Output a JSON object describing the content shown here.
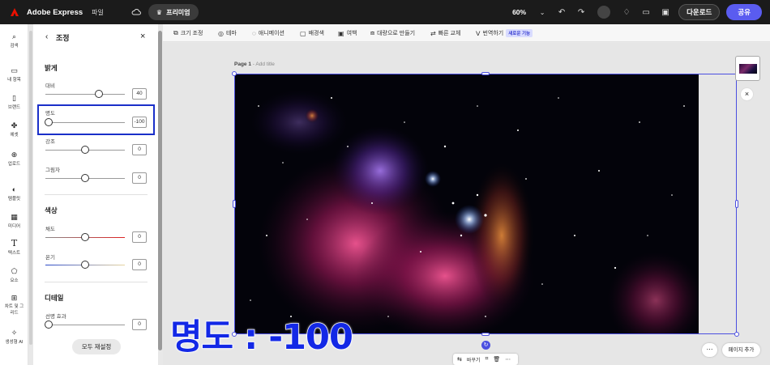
{
  "topbar": {
    "app_title": "Adobe Express",
    "file_menu": "파일",
    "premium_label": "프리미엄",
    "zoom": "60%",
    "download_label": "다운로드",
    "share_label": "공유"
  },
  "rail": {
    "items": [
      {
        "label": "검색",
        "icon": "search-icon"
      },
      {
        "label": "내 항목",
        "icon": "folder-icon"
      },
      {
        "label": "브랜드",
        "icon": "brand-icon"
      },
      {
        "label": "에셋",
        "icon": "assets-icon"
      },
      {
        "label": "업로드",
        "icon": "upload-icon"
      },
      {
        "label": "템플릿",
        "icon": "template-icon"
      },
      {
        "label": "미디어",
        "icon": "media-icon"
      },
      {
        "label": "텍스트",
        "icon": "text-icon"
      },
      {
        "label": "요소",
        "icon": "elements-icon"
      },
      {
        "label": "차트 및 그리드",
        "icon": "grid-icon"
      },
      {
        "label": "생성형 AI",
        "icon": "ai-icon"
      }
    ]
  },
  "panel": {
    "title": "조정",
    "light_section": "밝게",
    "contrast_label": "대비",
    "contrast_value": "40",
    "brightness_label": "명도",
    "brightness_value": "-100",
    "highlight_label": "강조",
    "highlight_value": "0",
    "shadow_label": "그림자",
    "shadow_value": "0",
    "color_section": "색상",
    "saturation_label": "채도",
    "saturation_value": "0",
    "temperature_label": "온기",
    "temperature_value": "0",
    "detail_section": "디테일",
    "sharpness_label": "선명 효과",
    "sharpness_value": "0",
    "reset_label": "모두 재설정"
  },
  "context_toolbar": {
    "resize": "크기 조정",
    "theme": "테마",
    "animation": "애니메이션",
    "background": "배경색",
    "margin": "여백",
    "make_video": "대량으로 만들기",
    "quick_replace": "빠른 교체",
    "translate": "번역하기",
    "new_badge": "새로운 기능"
  },
  "canvas": {
    "page_label": "Page 1",
    "page_title_placeholder": "- Add title",
    "replace_label": "바꾸기",
    "add_page_label": "페이지 추가"
  },
  "overlay": {
    "caption": "명도 : -100"
  },
  "colors": {
    "accent": "#5a5cf0",
    "selection": "#4b4fe0",
    "highlight_box": "#1a2fc9",
    "caption": "#1328e6"
  }
}
